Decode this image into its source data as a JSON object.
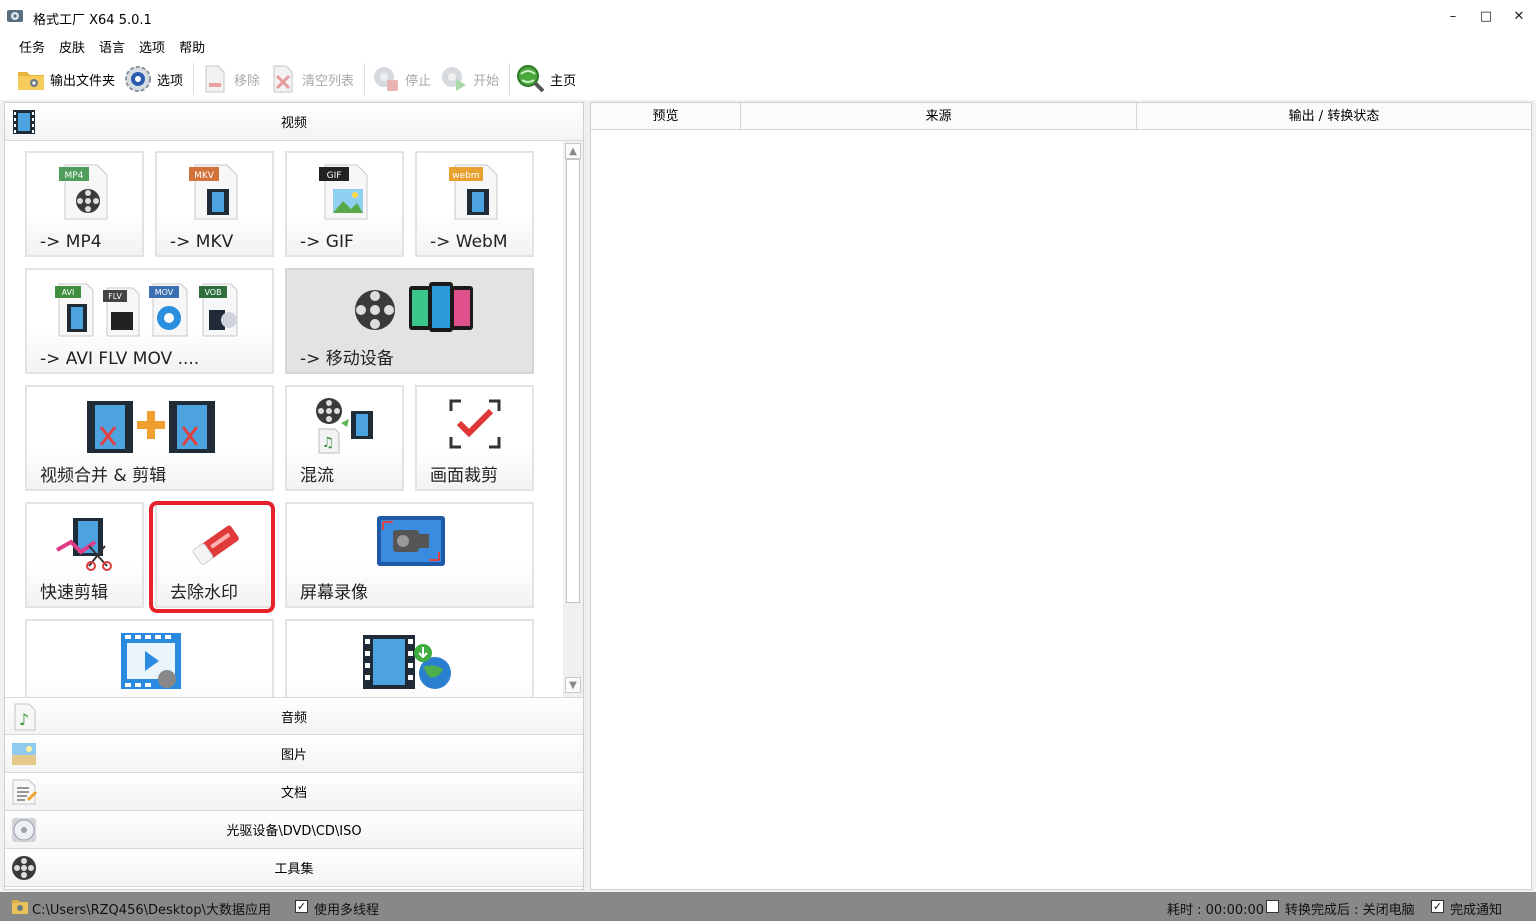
{
  "window": {
    "title": "格式工厂 X64 5.0.1",
    "minimize": "–",
    "maximize": "□",
    "close": "✕"
  },
  "menu": [
    "任务",
    "皮肤",
    "语言",
    "选项",
    "帮助"
  ],
  "toolbar": {
    "output_folder": "输出文件夹",
    "options": "选项",
    "remove": "移除",
    "clear_list": "清空列表",
    "stop": "停止",
    "start": "开始",
    "home": "主页"
  },
  "categories": {
    "video": "视频",
    "audio": "音频",
    "image": "图片",
    "document": "文档",
    "disc": "光驱设备\\DVD\\CD\\ISO",
    "tools": "工具集"
  },
  "tiles": {
    "mp4": {
      "label": "-> MP4",
      "badge": "MP4"
    },
    "mkv": {
      "label": "-> MKV",
      "badge": "MKV"
    },
    "gif": {
      "label": "-> GIF",
      "badge": "GIF"
    },
    "webm": {
      "label": "-> WebM",
      "badge": "webm"
    },
    "avi": {
      "label": "-> AVI FLV MOV ....",
      "badges": [
        "AVI",
        "FLV",
        "MOV",
        "VOB"
      ]
    },
    "mobile": {
      "label": "-> 移动设备"
    },
    "merge": {
      "label": "视频合并 & 剪辑"
    },
    "mux": {
      "label": "混流"
    },
    "crop": {
      "label": "画面裁剪"
    },
    "quickclip": {
      "label": "快速剪辑"
    },
    "watermark": {
      "label": "去除水印"
    },
    "record": {
      "label": "屏幕录像"
    }
  },
  "table": {
    "col_preview": "预览",
    "col_source": "来源",
    "col_status": "输出 / 转换状态"
  },
  "status": {
    "path": "C:\\Users\\RZQ456\\Desktop\\大数据应用",
    "multithread": "使用多线程",
    "elapsed": "耗时 : 00:00:00",
    "after_done": "转换完成后 : 关闭电脑",
    "notify": "完成通知",
    "multithread_checked": true,
    "after_done_checked": false,
    "notify_checked": true
  },
  "colors": {
    "highlight": "#e8222a",
    "statusbar": "#888888",
    "selected_tile": "#e3e3e3"
  }
}
